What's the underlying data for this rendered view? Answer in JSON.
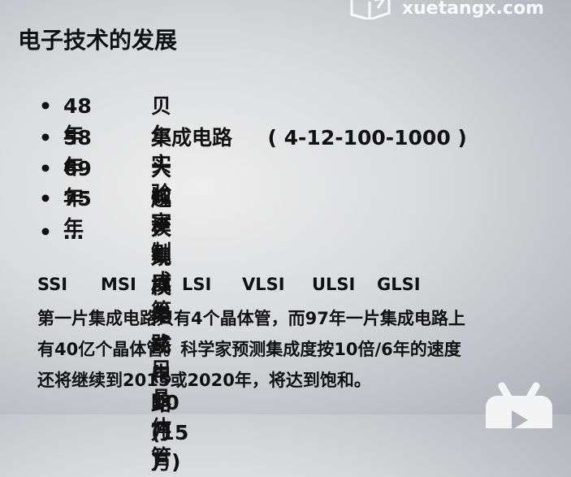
{
  "watermark": {
    "text": "xuetangx.com"
  },
  "slide": {
    "title": "电子技术的发展",
    "bullets": [
      {
        "year": "48年",
        "text": "贝尔实验室制成第一只晶体管"
      },
      {
        "year": "58年",
        "text": "集成电路     ( 4-12-100-1000 )"
      },
      {
        "year": "69年",
        "text": "大规模集成电路 ( 10万 )"
      },
      {
        "year": "75年",
        "text": "超大规模集成电路(15万)"
      },
      {
        "year": "…",
        "text": ""
      }
    ],
    "levels": [
      "SSI",
      "MSI",
      "LSI",
      "VLSI",
      "ULSI",
      "GLSI"
    ],
    "paragraph": [
      "第一片集成电路只有4个晶体管，而97年一片集成电路上",
      "有40亿个晶体管。科学家预测集成度按10倍/6年的速度",
      "还将继续到2015或2020年，将达到饱和。"
    ]
  }
}
